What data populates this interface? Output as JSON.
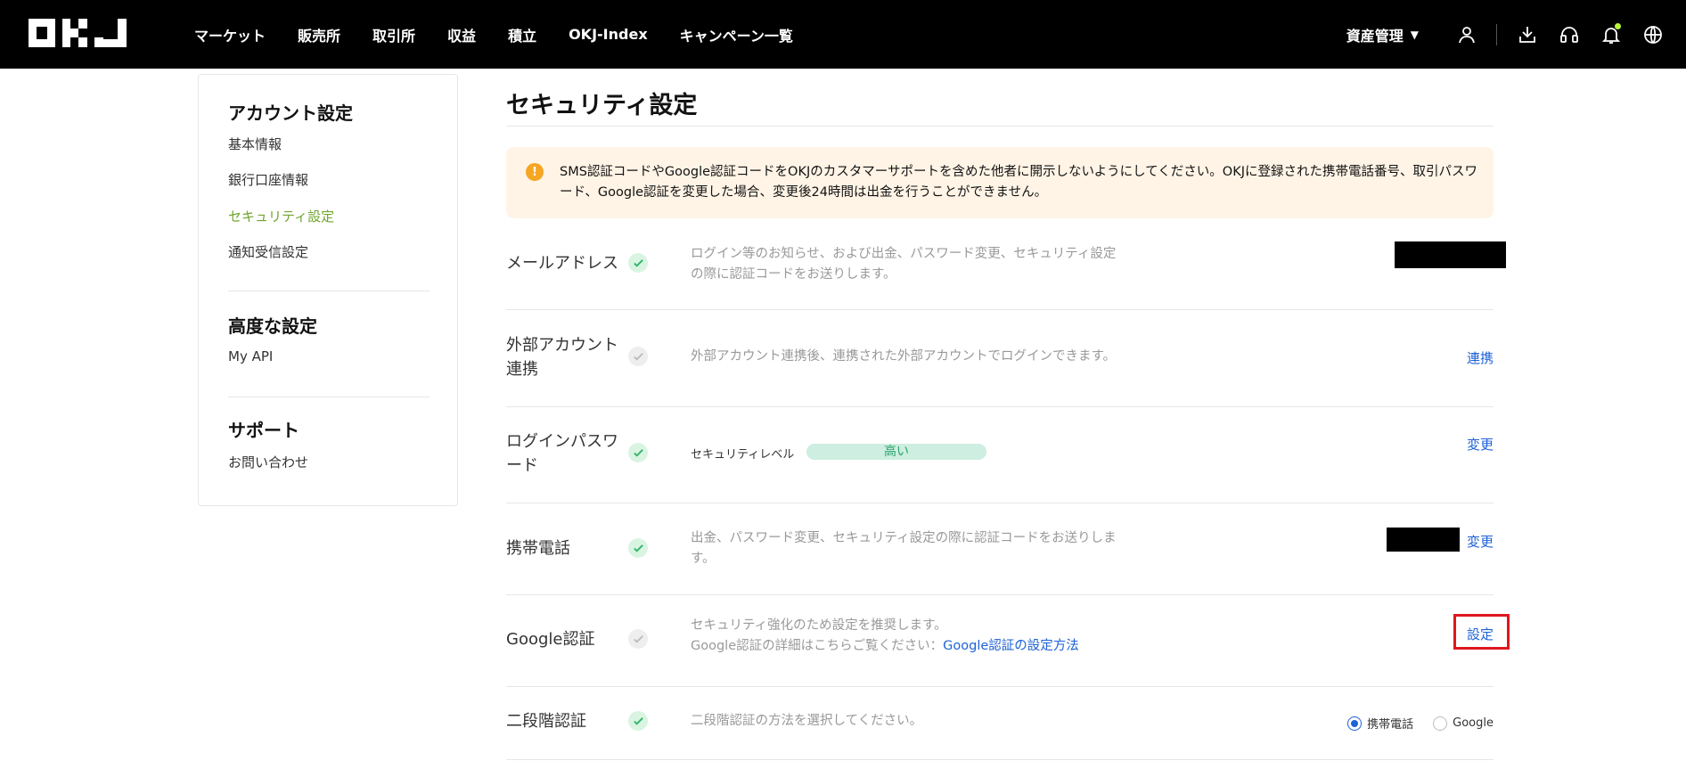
{
  "header": {
    "logo_text": "OKJ",
    "nav": [
      "マーケット",
      "販売所",
      "取引所",
      "収益",
      "積立",
      "OKJ-Index",
      "キャンペーン一覧"
    ],
    "asset_menu": "資産管理",
    "icons": [
      "user-icon",
      "download-icon",
      "headset-icon",
      "bell-icon",
      "globe-icon"
    ]
  },
  "sidebar": {
    "sections": [
      {
        "title": "アカウント設定",
        "items": [
          "基本情報",
          "銀行口座情報",
          "セキュリティ設定",
          "通知受信設定"
        ]
      },
      {
        "title": "高度な設定",
        "items": [
          "My API"
        ]
      },
      {
        "title": "サポート",
        "items": [
          "お問い合わせ"
        ]
      }
    ],
    "active_item": "セキュリティ設定"
  },
  "main": {
    "title": "セキュリティ設定",
    "warning": "SMS認証コードやGoogle認証コードをOKJのカスタマーサポートを含めた他者に開示しないようにしてください。OKJに登録された携帯電話番号、取引パスワード、Google認証を変更した場合、変更後24時間は出金を行うことができません。",
    "rows": [
      {
        "label": "メールアドレス",
        "status": "enabled",
        "desc": "ログイン等のお知らせ、および出金、パスワード変更、セキュリティ設定の際に認証コードをお送りします。",
        "action": ""
      },
      {
        "label": "外部アカウント連携",
        "status": "disabled",
        "desc": "外部アカウント連携後、連携された外部アカウントでログインできます。",
        "action": "連携"
      },
      {
        "label": "ログインパスワード",
        "status": "enabled",
        "level_label": "セキュリティレベル",
        "level_value": "高い",
        "action": "変更"
      },
      {
        "label": "携帯電話",
        "status": "enabled",
        "desc": "出金、パスワード変更、セキュリティ設定の際に認証コードをお送りします。",
        "action": "変更"
      },
      {
        "label": "Google認証",
        "status": "disabled",
        "desc": "セキュリティ強化のため設定を推奨します。",
        "desc2_prefix": "Google認証の詳細はこちらご覧ください：",
        "desc2_link": "Google認証の設定方法",
        "action": "設定"
      },
      {
        "label": "二段階認証",
        "status": "enabled",
        "desc": "二段階認証の方法を選択してください。",
        "options": [
          "携帯電話",
          "Google"
        ],
        "selected_option": "携帯電話"
      }
    ]
  },
  "colors": {
    "accent_link": "#1e62d6",
    "active_green": "#6fa52c",
    "highlight_red": "#e0171f"
  }
}
